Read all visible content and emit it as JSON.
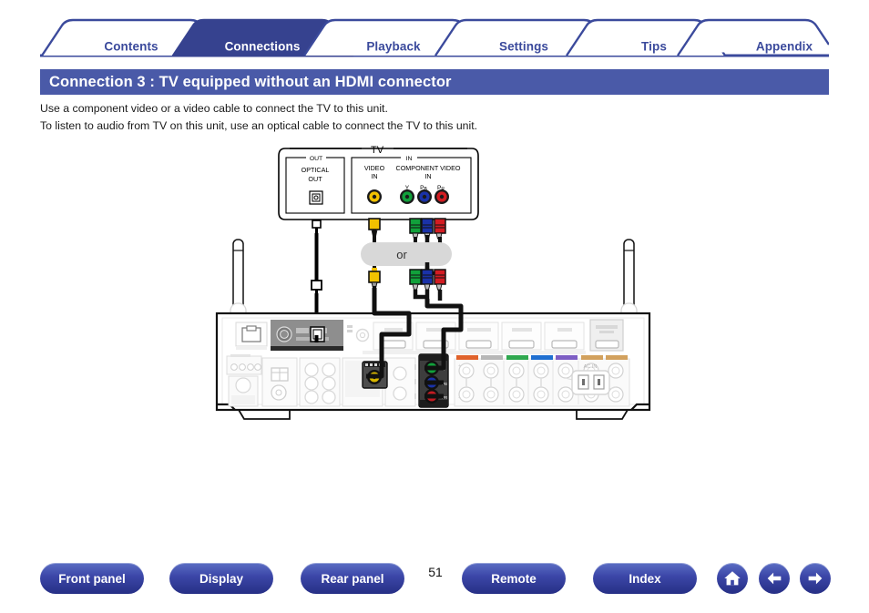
{
  "nav_tabs": [
    {
      "label": "Contents",
      "active": false
    },
    {
      "label": "Connections",
      "active": true
    },
    {
      "label": "Playback",
      "active": false
    },
    {
      "label": "Settings",
      "active": false
    },
    {
      "label": "Tips",
      "active": false
    },
    {
      "label": "Appendix",
      "active": false
    }
  ],
  "page": {
    "title": "Connection 3 : TV equipped without an HDMI connector",
    "paragraphs": [
      "Use a component video or a video cable to connect the TV to this unit.",
      "To listen to audio from TV on this unit, use an optical cable to connect the TV to this unit."
    ],
    "number": "51"
  },
  "diagram": {
    "tv": {
      "title": "TV",
      "out_group": "OUT",
      "in_group": "IN",
      "optical_label_line1": "OPTICAL",
      "optical_label_line2": "OUT",
      "video_label_line1": "VIDEO",
      "video_label_line2": "IN",
      "component_label_line1": "COMPONENT VIDEO",
      "component_label_line2": "IN",
      "component_jacks": [
        {
          "label": "Y",
          "sub": "",
          "color": "#11a13b"
        },
        {
          "label": "P",
          "sub": "B",
          "color": "#1a32a8"
        },
        {
          "label": "P",
          "sub": "R",
          "color": "#d31c22"
        }
      ],
      "video_jack_color": "#f2c200"
    },
    "or_badge": "or",
    "receiver": {
      "ac_in_label": "AC IN",
      "component_in_labels": [
        "Y",
        "PB",
        "PR"
      ],
      "component_in_colors": [
        "#11a13b",
        "#1a32a8",
        "#d31c22"
      ],
      "video_in_color": "#f2c200",
      "speaker_tag_colors": [
        "#e0622b",
        "#9aa0a6",
        "#2fa84f",
        "#1f6fd0",
        "#7a52c0",
        "#d2a15e",
        "#d2a15e"
      ]
    }
  },
  "footer": {
    "buttons": [
      {
        "label": "Front panel"
      },
      {
        "label": "Display"
      },
      {
        "label": "Rear panel"
      },
      {
        "label": "Remote"
      },
      {
        "label": "Index"
      }
    ],
    "icons": [
      {
        "name": "home-icon"
      },
      {
        "name": "arrow-left-icon"
      },
      {
        "name": "arrow-right-icon"
      }
    ]
  },
  "colors": {
    "accent": "#3b4a9c",
    "title_bg": "#4a5aa8",
    "tab_active_bg": "#36428f"
  }
}
